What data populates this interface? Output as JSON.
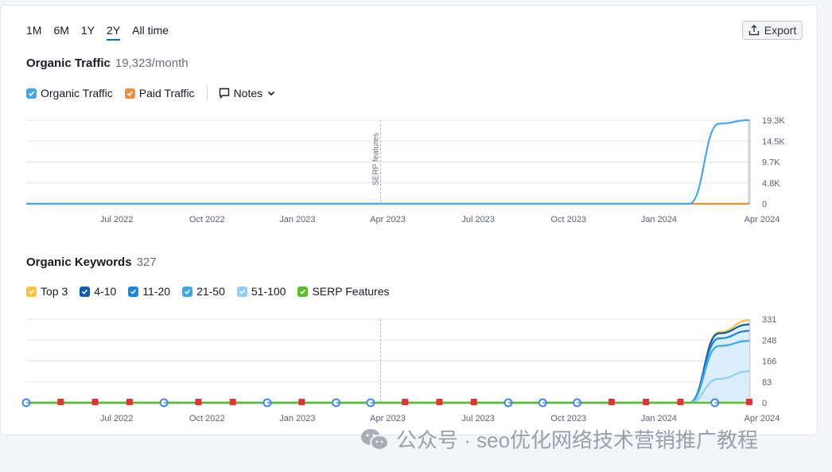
{
  "periods": [
    "1M",
    "6M",
    "1Y",
    "2Y",
    "All time"
  ],
  "active_period": "2Y",
  "export_label": "Export",
  "traffic": {
    "title": "Organic Traffic",
    "value": "19,323/month",
    "legend": [
      {
        "label": "Organic Traffic",
        "color": "#44a8ed"
      },
      {
        "label": "Paid Traffic",
        "color": "#f38d3c"
      }
    ],
    "notes_label": "Notes"
  },
  "keywords": {
    "title": "Organic Keywords",
    "value": "327",
    "legend": [
      {
        "label": "Top 3",
        "color": "#f9c33c"
      },
      {
        "label": "4-10",
        "color": "#0f5bb5"
      },
      {
        "label": "11-20",
        "color": "#1a86e0"
      },
      {
        "label": "21-50",
        "color": "#3da7f0"
      },
      {
        "label": "51-100",
        "color": "#8fcdfa"
      },
      {
        "label": "SERP Features",
        "color": "#5cbf2a"
      }
    ]
  },
  "annotation": "SERP features",
  "watermark": "公众号 · seo优化网络技术营销推广教程",
  "chart_data": [
    {
      "type": "line",
      "title": "Organic Traffic",
      "x_ticks": [
        "Jul 2022",
        "Oct 2022",
        "Jan 2023",
        "Apr 2023",
        "Jul 2023",
        "Oct 2023",
        "Jan 2024",
        "Apr 2024"
      ],
      "y_ticks": [
        "19.3K",
        "14.5K",
        "9.7K",
        "4.8K",
        "0"
      ],
      "ylim": [
        0,
        19300
      ],
      "x": [
        "2022-04",
        "2022-07",
        "2022-10",
        "2023-01",
        "2023-04",
        "2023-07",
        "2023-10",
        "2024-01",
        "2024-02",
        "2024-03",
        "2024-04"
      ],
      "series": [
        {
          "name": "Organic Traffic",
          "color": "#44a8ed",
          "values": [
            0,
            0,
            0,
            0,
            0,
            0,
            0,
            0,
            0,
            18500,
            19323
          ]
        },
        {
          "name": "Paid Traffic",
          "color": "#f38d3c",
          "values": [
            0,
            0,
            0,
            0,
            0,
            0,
            0,
            0,
            0,
            0,
            0
          ]
        }
      ],
      "annotation": "SERP features"
    },
    {
      "type": "area",
      "title": "Organic Keywords",
      "x_ticks": [
        "Jul 2022",
        "Oct 2022",
        "Jan 2023",
        "Apr 2023",
        "Jul 2023",
        "Oct 2023",
        "Jan 2024",
        "Apr 2024"
      ],
      "y_ticks": [
        "331",
        "248",
        "166",
        "83",
        "0"
      ],
      "ylim": [
        0,
        331
      ],
      "x": [
        "2022-04",
        "2022-07",
        "2022-10",
        "2023-01",
        "2023-04",
        "2023-07",
        "2023-10",
        "2024-01",
        "2024-02",
        "2024-03",
        "2024-04"
      ],
      "series": [
        {
          "name": "Top 3",
          "color": "#f9c33c",
          "values": [
            0,
            0,
            0,
            0,
            0,
            0,
            0,
            0,
            0,
            280,
            327
          ]
        },
        {
          "name": "4-10",
          "color": "#0f5bb5",
          "values": [
            0,
            0,
            0,
            0,
            0,
            0,
            0,
            0,
            0,
            275,
            310
          ]
        },
        {
          "name": "11-20",
          "color": "#1a86e0",
          "values": [
            0,
            0,
            0,
            0,
            0,
            0,
            0,
            0,
            0,
            255,
            285
          ]
        },
        {
          "name": "21-50",
          "color": "#3da7f0",
          "values": [
            0,
            0,
            0,
            0,
            0,
            0,
            0,
            0,
            0,
            225,
            245
          ]
        },
        {
          "name": "51-100",
          "color": "#8fcdfa",
          "values": [
            0,
            0,
            0,
            0,
            0,
            0,
            0,
            0,
            0,
            95,
            125
          ]
        },
        {
          "name": "SERP Features",
          "color": "#5cbf2a",
          "values": [
            0,
            0,
            0,
            0,
            0,
            0,
            0,
            0,
            0,
            0,
            0
          ]
        }
      ]
    }
  ]
}
